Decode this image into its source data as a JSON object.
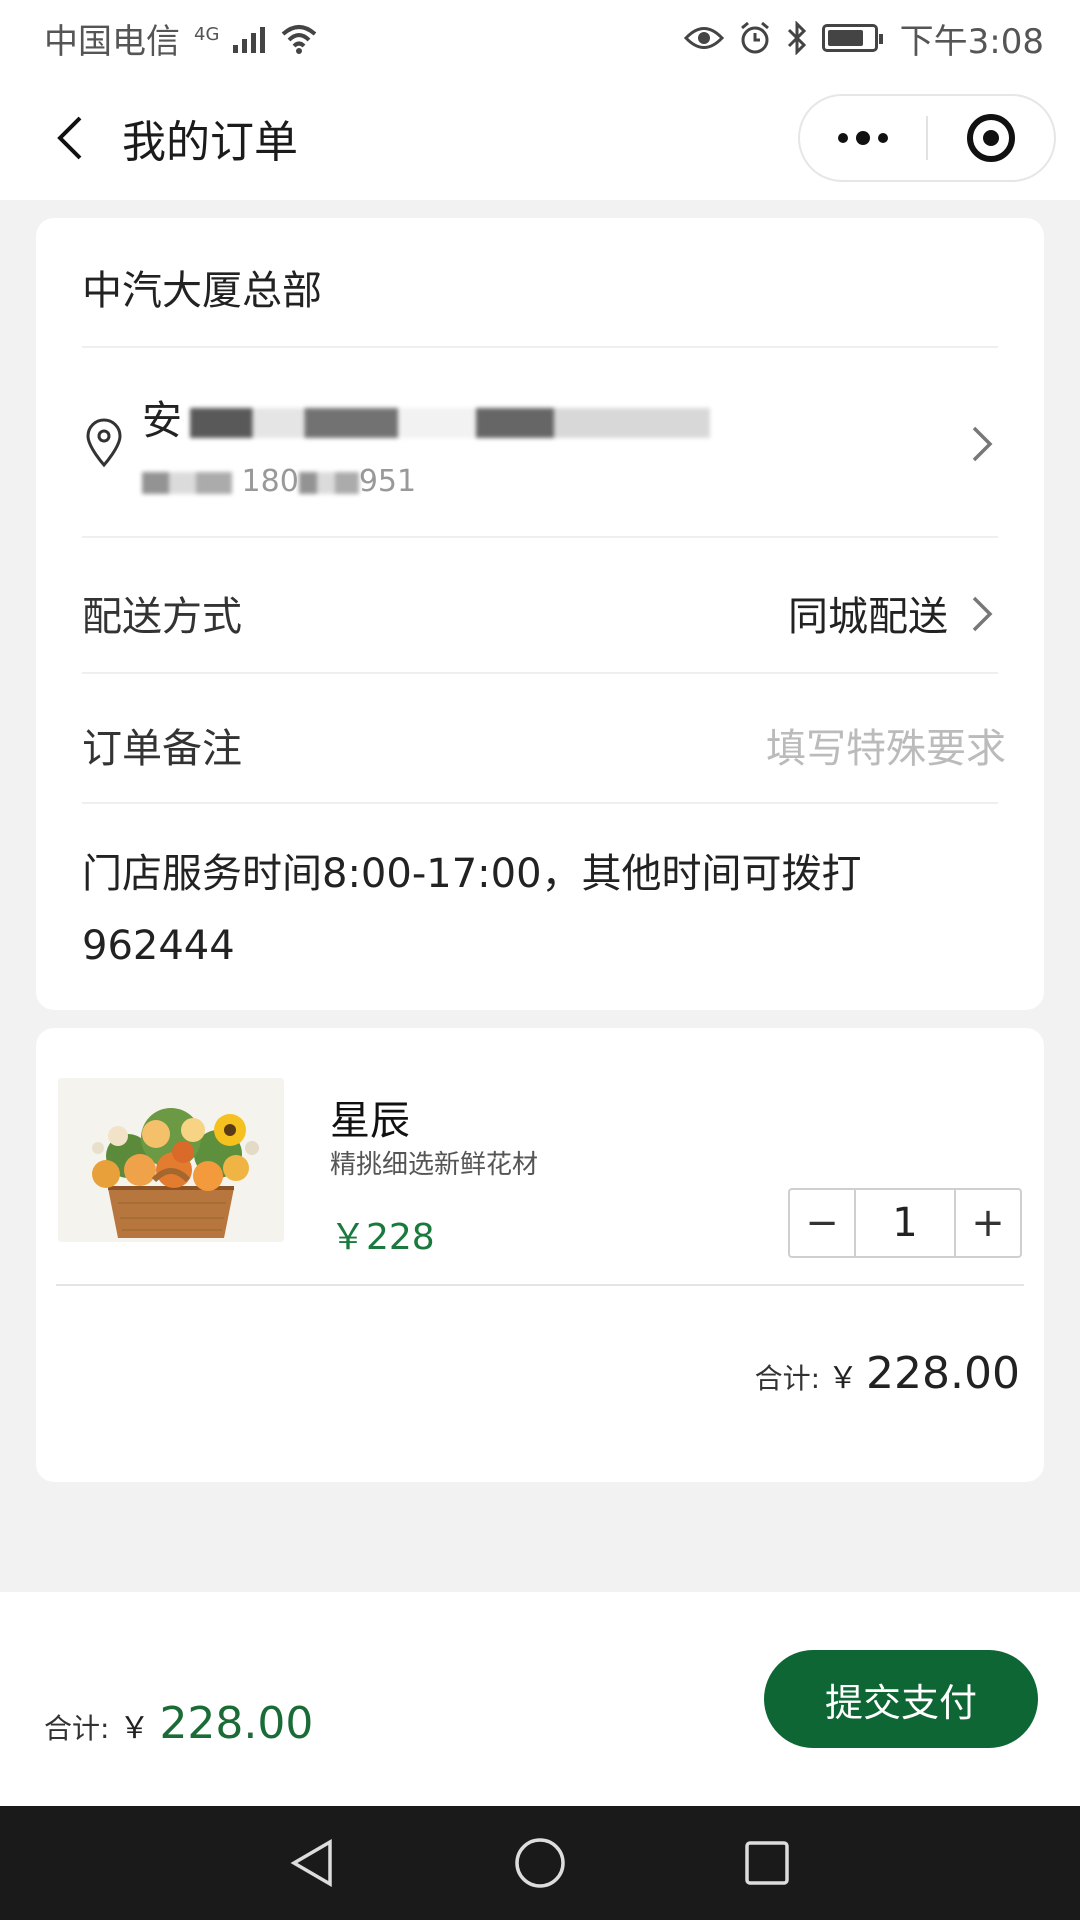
{
  "status_bar": {
    "carrier": "中国电信",
    "network": "4G",
    "time": "下午3:08"
  },
  "nav": {
    "title": "我的订单"
  },
  "order": {
    "store_name": "中汽大厦总部",
    "address_prefix": "安",
    "phone_partial": "180",
    "phone_tail": "951",
    "delivery": {
      "label": "配送方式",
      "value": "同城配送"
    },
    "remark": {
      "label": "订单备注",
      "placeholder": "填写特殊要求"
    },
    "notice": "门店服务时间8:00-17:00，其他时间可拨打962444"
  },
  "product": {
    "name": "星辰",
    "description": "精挑细选新鲜花材",
    "price": "￥228",
    "quantity": "1",
    "minus": "−",
    "plus": "+"
  },
  "card_total": {
    "label": "合计:",
    "currency": "￥",
    "amount": "228.00"
  },
  "footer": {
    "label": "合计:",
    "currency": "￥",
    "amount": "228.00",
    "submit_label": "提交支付"
  },
  "colors": {
    "accent": "#0d6633",
    "price_green": "#1a7a3e"
  }
}
